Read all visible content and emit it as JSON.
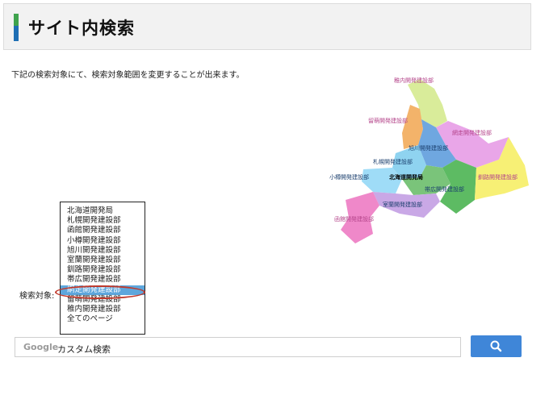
{
  "header": {
    "title": "サイト内検索"
  },
  "description": "下記の検索対象にて、検索対象範囲を変更することが出来ます。",
  "map": {
    "labels": {
      "wakkanai": "稚内開発建設部",
      "rumoi": "留萌開発建設部",
      "abashiri": "網走開発建設部",
      "asahikawa": "旭川開発建設部",
      "sapporo": "札幌開発建設部",
      "otaru": "小樽開発建設部",
      "hq": "北海道開発局",
      "obihiro": "帯広開発建設部",
      "kushiro": "釧路開発建設部",
      "muroran": "室蘭開発建設部",
      "hakodate": "函館開発建設部"
    }
  },
  "search": {
    "target_label": "検索対象:",
    "options": [
      "北海道開発局",
      "札幌開発建設部",
      "函館開発建設部",
      "小樽開発建設部",
      "旭川開発建設部",
      "室蘭開発建設部",
      "釧路開発建設部",
      "帯広開発建設部",
      "網走開発建設部",
      "留萌開発建設部",
      "稚内開発建設部",
      "全てのページ"
    ],
    "selected": "網走開発建設部",
    "google_logo": "Google",
    "placeholder": "カスタム検索",
    "button_icon": "search-icon"
  },
  "colors": {
    "accent_green": "#3fa34d",
    "accent_blue": "#1f6fb4",
    "button_blue": "#3f86d8",
    "selection_blue": "#5da6dc",
    "highlight_red": "#c0392b"
  }
}
